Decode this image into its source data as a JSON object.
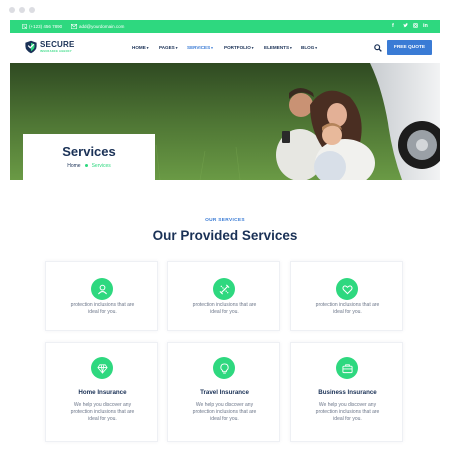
{
  "topbar": {
    "phone": "(+123) 456 7890",
    "email": "add@yourdomain.com",
    "social_icons": [
      "facebook-icon",
      "twitter-icon",
      "instagram-icon",
      "linkedin-icon"
    ],
    "social_glyphs": [
      "f",
      "•",
      "◎",
      "in"
    ]
  },
  "brand": {
    "name": "SECURE",
    "tagline": "INSURANCE AGENCY",
    "accent": "#2ed87f",
    "primary": "#3a7bd5",
    "navy": "#1a3156"
  },
  "nav": {
    "items": [
      {
        "label": "HOME"
      },
      {
        "label": "PAGES"
      },
      {
        "label": "SERVICES"
      },
      {
        "label": "PORTFOLIO"
      },
      {
        "label": "ELEMENTS"
      },
      {
        "label": "BLOG"
      }
    ],
    "active": "SERVICES",
    "caret": "▾",
    "cta_label": "FREE QUOTE"
  },
  "hero": {
    "title": "Services",
    "breadcrumb_home": "Home",
    "breadcrumb_current": "Services"
  },
  "section": {
    "eyebrow": "OUR SERVICES",
    "title": "Our Provided Services"
  },
  "cards": [
    {
      "icon": "user-icon",
      "title": "",
      "desc_lines": [
        "protection inclusions that are",
        "ideal for you."
      ]
    },
    {
      "icon": "tools-icon",
      "title": "",
      "desc_lines": [
        "protection inclusions that are",
        "ideal for you."
      ]
    },
    {
      "icon": "heart-icon",
      "title": "",
      "desc_lines": [
        "protection inclusions that are",
        "ideal for you."
      ]
    },
    {
      "icon": "diamond-icon",
      "title": "Home Insurance",
      "desc_lines": [
        "We help you discover any",
        "protection inclusions that are",
        "ideal for you."
      ]
    },
    {
      "icon": "lightbulb-icon",
      "title": "Travel Insurance",
      "desc_lines": [
        "We help you discover any",
        "protection inclusions that are",
        "ideal for you."
      ]
    },
    {
      "icon": "briefcase-icon",
      "title": "Business Insurance",
      "desc_lines": [
        "We help you discover any",
        "protection inclusions that are",
        "ideal for you."
      ]
    }
  ]
}
